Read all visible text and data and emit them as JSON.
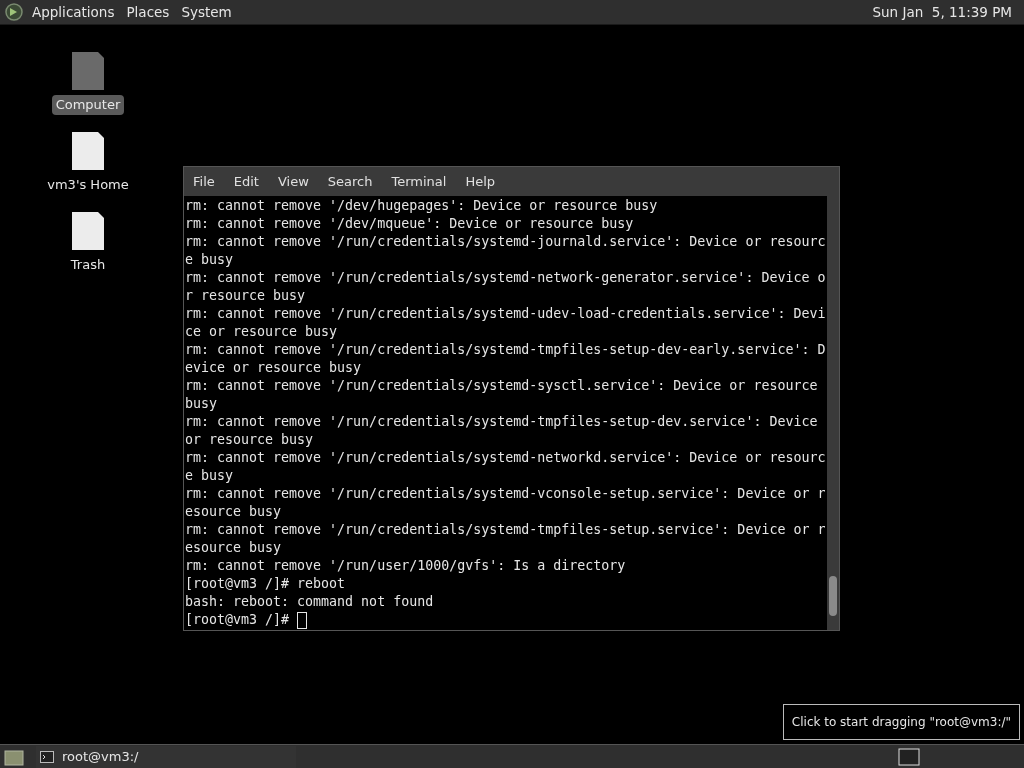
{
  "top_panel": {
    "menus": [
      "Applications",
      "Places",
      "System"
    ],
    "clock": "Sun Jan  5, 11:39 PM"
  },
  "desktop_icons": [
    {
      "label": "Computer",
      "selected": true,
      "kind": "computer"
    },
    {
      "label": "vm3's Home",
      "selected": false,
      "kind": "file"
    },
    {
      "label": "Trash",
      "selected": false,
      "kind": "file"
    }
  ],
  "terminal": {
    "menu": [
      "File",
      "Edit",
      "View",
      "Search",
      "Terminal",
      "Help"
    ],
    "lines": [
      "rm: cannot remove '/dev/hugepages': Device or resource busy",
      "rm: cannot remove '/dev/mqueue': Device or resource busy",
      "rm: cannot remove '/run/credentials/systemd-journald.service': Device or resourc",
      "e busy",
      "rm: cannot remove '/run/credentials/systemd-network-generator.service': Device o",
      "r resource busy",
      "rm: cannot remove '/run/credentials/systemd-udev-load-credentials.service': Devi",
      "ce or resource busy",
      "rm: cannot remove '/run/credentials/systemd-tmpfiles-setup-dev-early.service': D",
      "evice or resource busy",
      "rm: cannot remove '/run/credentials/systemd-sysctl.service': Device or resource",
      "busy",
      "rm: cannot remove '/run/credentials/systemd-tmpfiles-setup-dev.service': Device",
      "or resource busy",
      "rm: cannot remove '/run/credentials/systemd-networkd.service': Device or resourc",
      "e busy",
      "rm: cannot remove '/run/credentials/systemd-vconsole-setup.service': Device or r",
      "esource busy",
      "rm: cannot remove '/run/credentials/systemd-tmpfiles-setup.service': Device or r",
      "esource busy",
      "rm: cannot remove '/run/user/1000/gvfs': Is a directory",
      "[root@vm3 /]# reboot",
      "bash: reboot: command not found",
      "[root@vm3 /]# "
    ]
  },
  "tooltip": "Click to start dragging \"root@vm3:/\"",
  "taskbar": {
    "tasks": [
      "root@vm3:/"
    ]
  }
}
